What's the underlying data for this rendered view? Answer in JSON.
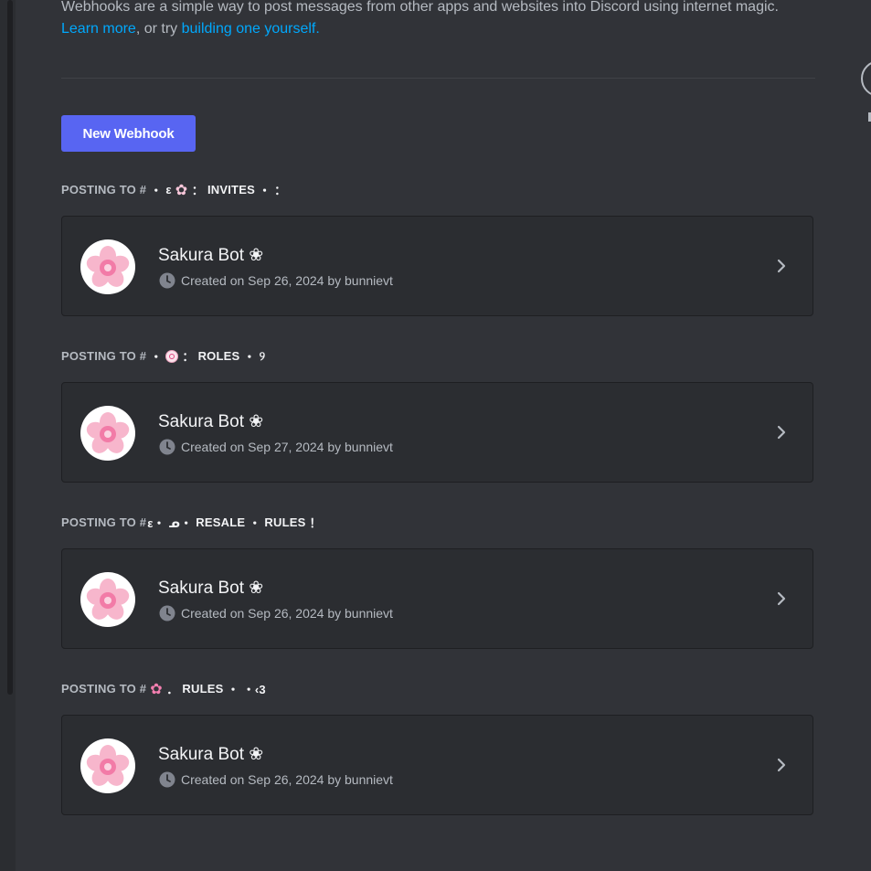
{
  "intro": {
    "text": "Webhooks are a simple way to post messages from other apps and websites into Discord using internet magic.",
    "learn_more": "Learn more",
    "or_try": ", or try ",
    "build_link": "building one yourself."
  },
  "new_webhook_label": "New Webhook",
  "sections": [
    {
      "prefix": "POSTING TO #",
      "channel_parts": [
        "・",
        "ε",
        "INVITES",
        "・",
        "："
      ],
      "webhook": {
        "name": "Sakura Bot ❀",
        "created": "Created on Sep 26, 2024 by bunnievt"
      }
    },
    {
      "prefix": "POSTING TO #",
      "channel_parts": [
        "・",
        "：",
        "ROLES",
        "・",
        "୨"
      ],
      "webhook": {
        "name": "Sakura Bot ❀",
        "created": "Created on Sep 27, 2024 by bunnievt"
      }
    },
    {
      "prefix": "POSTING TO #",
      "channel_parts": [
        "ε・",
        "ᓄ・",
        "RESALE",
        "・",
        "RULES",
        "！"
      ],
      "webhook": {
        "name": "Sakura Bot ❀",
        "created": "Created on Sep 26, 2024 by bunnievt"
      }
    },
    {
      "prefix": "POSTING TO #",
      "channel_parts": [
        "．",
        "RULES",
        "・",
        "・‹3"
      ],
      "webhook": {
        "name": "Sakura Bot ❀",
        "created": "Created on Sep 26, 2024 by bunnievt"
      }
    }
  ],
  "icons": {
    "clock": "clock-icon",
    "chevron": "chevron-right-icon",
    "avatar": "sakura-avatar"
  },
  "colors": {
    "accent": "#5865f2",
    "link": "#00a8fc",
    "background": "#313338",
    "card": "#2b2d31"
  }
}
